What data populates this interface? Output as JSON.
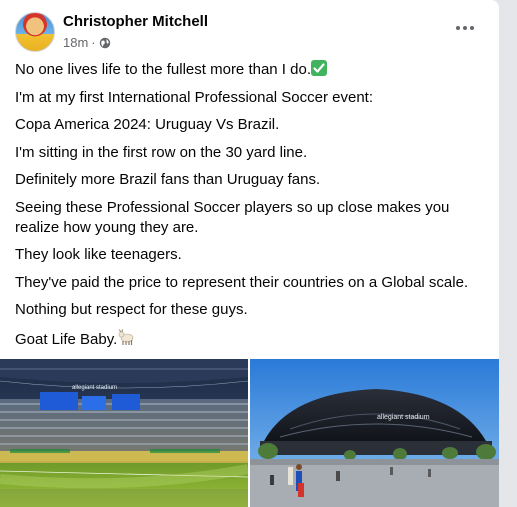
{
  "post": {
    "author": "Christopher Mitchell",
    "time": "18m",
    "separator": "·",
    "privacy_icon": "globe-icon",
    "more_icon": "more-horizontal-icon",
    "paragraphs": [
      "No one lives life to the fullest more than I do.",
      "I'm at my first International Professional Soccer event:",
      "Copa America 2024: Uruguay Vs Brazil.",
      "I'm sitting in the first row on the 30 yard line.",
      "Definitely more Brazil fans than Uruguay fans.",
      "Seeing these Professional Soccer players so up close makes you realize how young they are.",
      "They look like teenagers.",
      "They've paid the price to represent their countries on a Global scale.",
      "Nothing but respect for these guys.",
      "Goat Life Baby."
    ],
    "emoji": {
      "check": "check-mark-icon",
      "goat": "goat-icon"
    }
  },
  "photos": [
    {
      "name": "stadium-interior-photo",
      "sign": "allegiant stadium"
    },
    {
      "name": "stadium-exterior-photo",
      "sign": "allegiant stadium"
    }
  ],
  "colors": {
    "text": "#050505",
    "meta": "#65676b",
    "check_green": "#41b35d",
    "background": "#e4e6ea"
  }
}
